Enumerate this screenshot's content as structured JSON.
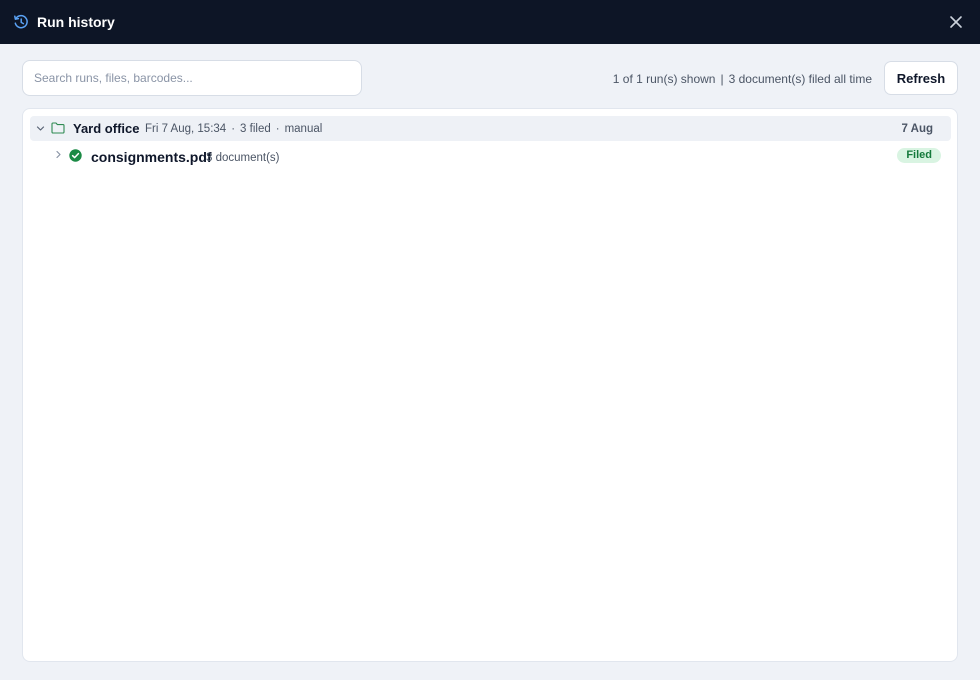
{
  "window": {
    "title": "Run history",
    "title_icon": "history-icon",
    "close_icon": "close-icon"
  },
  "toolbar": {
    "search_placeholder": "Search runs, files, barcodes...",
    "search_value": "",
    "runs_shown": "1 of 1 run(s) shown",
    "separator": "|",
    "docs_filed": "3 document(s) filed all time",
    "refresh_label": "Refresh"
  },
  "groups": [
    {
      "name": "Yard office",
      "datetime": "Fri 7 Aug, 15:34",
      "filed": "3 filed",
      "mode": "manual",
      "date_short": "7 Aug",
      "dot": "·",
      "files": [
        {
          "name": "consignments.pdf",
          "count": "3 document(s)",
          "status": "Filed"
        }
      ]
    }
  ],
  "colors": {
    "titlebar_bg": "#0d1526",
    "accent_blue": "#5aa2f5",
    "success_green": "#1b8a45",
    "badge_bg": "#d9f4e2",
    "folder_green": "#2f8a52"
  }
}
